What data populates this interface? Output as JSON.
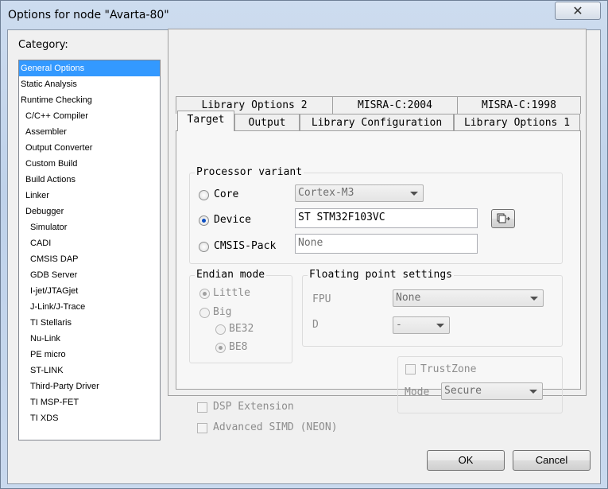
{
  "window": {
    "title": "Options for node \"Avarta-80\"",
    "close_glyph": "✕"
  },
  "category": {
    "label": "Category:",
    "items": [
      {
        "label": "General Options",
        "selected": true
      },
      {
        "label": "Static Analysis"
      },
      {
        "label": "Runtime Checking"
      },
      {
        "label": "C/C++ Compiler"
      },
      {
        "label": "Assembler"
      },
      {
        "label": "Output Converter"
      },
      {
        "label": "Custom Build"
      },
      {
        "label": "Build Actions"
      },
      {
        "label": "Linker"
      },
      {
        "label": "Debugger"
      },
      {
        "label": "Simulator"
      },
      {
        "label": "CADI"
      },
      {
        "label": "CMSIS DAP"
      },
      {
        "label": "GDB Server"
      },
      {
        "label": "I-jet/JTAGjet"
      },
      {
        "label": "J-Link/J-Trace"
      },
      {
        "label": "TI Stellaris"
      },
      {
        "label": "Nu-Link"
      },
      {
        "label": "PE micro"
      },
      {
        "label": "ST-LINK"
      },
      {
        "label": "Third-Party Driver"
      },
      {
        "label": "TI MSP-FET"
      },
      {
        "label": "TI XDS"
      }
    ]
  },
  "tabs": {
    "back_row": [
      "Library Options 2",
      "MISRA-C:2004",
      "MISRA-C:1998"
    ],
    "front_row": [
      "Target",
      "Output",
      "Library Configuration",
      "Library Options 1"
    ],
    "active": "Target"
  },
  "processor": {
    "title": "Processor variant",
    "core_label": "Core",
    "core_value": "Cortex-M3",
    "device_label": "Device",
    "device_value": "ST STM32F103VC",
    "device_button_icon": "select-device-icon",
    "cmsis_label": "CMSIS-Pack",
    "cmsis_value": "None",
    "selected": "Device"
  },
  "endian": {
    "title": "Endian mode",
    "little": "Little",
    "big": "Big",
    "be32": "BE32",
    "be8": "BE8"
  },
  "float": {
    "title": "Floating point settings",
    "fpu_label": "FPU",
    "fpu_value": "None",
    "d_label": "D",
    "d_value": "-"
  },
  "options": {
    "dsp": "DSP Extension",
    "simd": "Advanced SIMD (NEON)"
  },
  "trustzone": {
    "label": "TrustZone",
    "mode_label": "Mode",
    "mode_value": "Secure"
  },
  "buttons": {
    "ok": "OK",
    "cancel": "Cancel"
  }
}
